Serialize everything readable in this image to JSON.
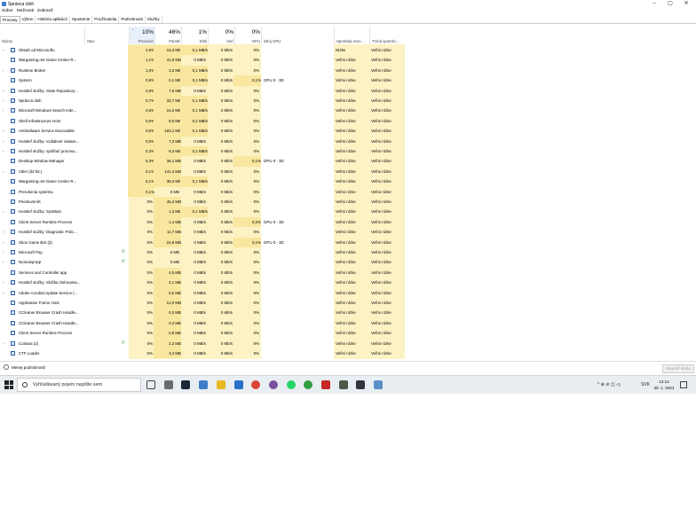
{
  "window": {
    "title": "Správca úloh",
    "minimize": "–",
    "maximize": "▢",
    "close": "✕"
  },
  "menu": [
    "Súbor",
    "Možnosti",
    "Zobraziť"
  ],
  "tabs": [
    "Procesy",
    "Výkon",
    "História aplikácií",
    "Spustenie",
    "Používatelia",
    "Podrobnosti",
    "Služby"
  ],
  "columns": {
    "name": "Názov",
    "status": "Stav",
    "cpu": {
      "pct": "10%",
      "label": "Procesor"
    },
    "mem": {
      "pct": "46%",
      "label": "Pamäť"
    },
    "disk": {
      "pct": "1%",
      "label": "Disk"
    },
    "net": {
      "pct": "0%",
      "label": "Sieť"
    },
    "gpu": {
      "pct": "0%",
      "label": "GPU"
    },
    "gpu_engine": "Stroj GPU",
    "power": "Spotreba ener...",
    "power_trend": "Trend spotreb..."
  },
  "rows": [
    {
      "name": "Obsah od Microsoftu",
      "cpu": "2,6%",
      "mem": "16,3 MB",
      "disk": "0,1 MB/s",
      "net": "0 Mb/s",
      "gpu": "0%",
      "engine": "",
      "power": "Nízke",
      "trend": "Veľmi nízke",
      "expand": true,
      "leaf": false
    },
    {
      "name": "Wargaming.net Game Center R...",
      "cpu": "1,1%",
      "mem": "41,9 MB",
      "disk": "0 MB/s",
      "net": "0 Mb/s",
      "gpu": "0%",
      "engine": "",
      "power": "Veľmi nízke",
      "trend": "Veľmi nízke",
      "expand": false,
      "leaf": false
    },
    {
      "name": "Runtime Broker",
      "cpu": "1,0%",
      "mem": "3,2 MB",
      "disk": "0,1 MB/s",
      "net": "0 Mb/s",
      "gpu": "0%",
      "engine": "",
      "power": "Veľmi nízke",
      "trend": "Veľmi nízke",
      "expand": true,
      "leaf": false
    },
    {
      "name": "System",
      "cpu": "0,9%",
      "mem": "0,1 MB",
      "disk": "0,1 MB/s",
      "net": "0 Mb/s",
      "gpu": "0,1%",
      "engine": "GPU 0 - 3D",
      "power": "Veľmi nízke",
      "trend": "Veľmi nízke",
      "expand": false,
      "leaf": false
    },
    {
      "name": "Hostiteľ služby: State Repository...",
      "cpu": "0,9%",
      "mem": "7,6 MB",
      "disk": "0 MB/s",
      "net": "0 Mb/s",
      "gpu": "0%",
      "engine": "",
      "power": "Veľmi nízke",
      "trend": "Veľmi nízke",
      "expand": true,
      "leaf": false
    },
    {
      "name": "Správca úloh",
      "cpu": "0,7%",
      "mem": "33,7 MB",
      "disk": "0,1 MB/s",
      "net": "0 Mb/s",
      "gpu": "0%",
      "engine": "",
      "power": "Veľmi nízke",
      "trend": "Veľmi nízke",
      "expand": true,
      "leaf": false
    },
    {
      "name": "Microsoft Windows Search Inde...",
      "cpu": "0,6%",
      "mem": "16,2 MB",
      "disk": "0,1 MB/s",
      "net": "0 Mb/s",
      "gpu": "0%",
      "engine": "",
      "power": "Veľmi nízke",
      "trend": "Veľmi nízke",
      "expand": true,
      "leaf": false
    },
    {
      "name": "Shell Infrastructure Host",
      "cpu": "0,6%",
      "mem": "8,0 MB",
      "disk": "0,1 MB/s",
      "net": "0 Mb/s",
      "gpu": "0%",
      "engine": "",
      "power": "Veľmi nízke",
      "trend": "Veľmi nízke",
      "expand": false,
      "leaf": false
    },
    {
      "name": "Antimalware Service Executable",
      "cpu": "0,5%",
      "mem": "183,1 MB",
      "disk": "0,1 MB/s",
      "net": "0 Mb/s",
      "gpu": "0%",
      "engine": "",
      "power": "Veľmi nízke",
      "trend": "Veľmi nízke",
      "expand": true,
      "leaf": false
    },
    {
      "name": "Hostiteľ služby: vzdialené volanie...",
      "cpu": "0,5%",
      "mem": "7,3 MB",
      "disk": "0 MB/s",
      "net": "0 Mb/s",
      "gpu": "0%",
      "engine": "",
      "power": "Veľmi nízke",
      "trend": "Veľmi nízke",
      "expand": true,
      "leaf": false
    },
    {
      "name": "Hostiteľ služby: spúšťač procesu...",
      "cpu": "0,3%",
      "mem": "9,3 MB",
      "disk": "0,1 MB/s",
      "net": "0 Mb/s",
      "gpu": "0%",
      "engine": "",
      "power": "Veľmi nízke",
      "trend": "Veľmi nízke",
      "expand": true,
      "leaf": false
    },
    {
      "name": "Desktop Window Manager",
      "cpu": "0,3%",
      "mem": "36,1 MB",
      "disk": "0 MB/s",
      "net": "0 Mb/s",
      "gpu": "0,1%",
      "engine": "GPU 0 - 3D",
      "power": "Veľmi nízke",
      "trend": "Veľmi nízke",
      "expand": false,
      "leaf": false
    },
    {
      "name": "Viber (32 bit.)",
      "cpu": "0,1%",
      "mem": "141,4 MB",
      "disk": "0 MB/s",
      "net": "0 Mb/s",
      "gpu": "0%",
      "engine": "",
      "power": "Veľmi nízke",
      "trend": "Veľmi nízke",
      "expand": true,
      "leaf": false
    },
    {
      "name": "Wargaming.net Game Center R...",
      "cpu": "0,1%",
      "mem": "38,4 MB",
      "disk": "0,1 MB/s",
      "net": "0 Mb/s",
      "gpu": "0%",
      "engine": "",
      "power": "Veľmi nízke",
      "trend": "Veľmi nízke",
      "expand": false,
      "leaf": false
    },
    {
      "name": "Prerušenia systému",
      "cpu": "0,1%",
      "mem": "0 MB",
      "disk": "0 MB/s",
      "net": "0 Mb/s",
      "gpu": "0%",
      "engine": "",
      "power": "Veľmi nízke",
      "trend": "Veľmi nízke",
      "expand": false,
      "leaf": false
    },
    {
      "name": "PrieskumníK",
      "cpu": "0%",
      "mem": "45,4 MB",
      "disk": "0 MB/s",
      "net": "0 Mb/s",
      "gpu": "0%",
      "engine": "",
      "power": "Veľmi nízke",
      "trend": "Veľmi nízke",
      "expand": false,
      "leaf": false
    },
    {
      "name": "Hostiteľ služby: SysMain",
      "cpu": "0%",
      "mem": "1,3 MB",
      "disk": "0,1 MB/s",
      "net": "0 Mb/s",
      "gpu": "0%",
      "engine": "",
      "power": "Veľmi nízke",
      "trend": "Veľmi nízke",
      "expand": true,
      "leaf": false
    },
    {
      "name": "Client Server Runtime Process",
      "cpu": "0%",
      "mem": "1,4 MB",
      "disk": "0 MB/s",
      "net": "0 Mb/s",
      "gpu": "0,2%",
      "engine": "GPU 0 - 3D",
      "power": "Veľmi nízke",
      "trend": "Veľmi nízke",
      "expand": false,
      "leaf": false
    },
    {
      "name": "Hostiteľ služby: Diagnostic Polic...",
      "cpu": "0%",
      "mem": "11,7 MB",
      "disk": "0 MB/s",
      "net": "0 Mb/s",
      "gpu": "0%",
      "engine": "",
      "power": "Veľmi nízke",
      "trend": "Veľmi nízke",
      "expand": true,
      "leaf": false
    },
    {
      "name": "Xbox Game Bar (3)",
      "cpu": "0%",
      "mem": "24,9 MB",
      "disk": "0 MB/s",
      "net": "0 Mb/s",
      "gpu": "0,1%",
      "engine": "GPU 0 - 3D",
      "power": "Veľmi nízke",
      "trend": "Veľmi nízke",
      "expand": true,
      "leaf": false
    },
    {
      "name": "Microsoft Pay",
      "cpu": "0%",
      "mem": "0 MB",
      "disk": "0 MB/s",
      "net": "0 Mb/s",
      "gpu": "0%",
      "engine": "",
      "power": "Veľmi nízke",
      "trend": "Veľmi nízke",
      "expand": true,
      "leaf": true
    },
    {
      "name": "NcsiUwpApp",
      "cpu": "0%",
      "mem": "0 MB",
      "disk": "0 MB/s",
      "net": "0 Mb/s",
      "gpu": "0%",
      "engine": "",
      "power": "Veľmi nízke",
      "trend": "Veľmi nízke",
      "expand": true,
      "leaf": true
    },
    {
      "name": "Services and Controller app",
      "cpu": "0%",
      "mem": "4,5 MB",
      "disk": "0 MB/s",
      "net": "0 Mb/s",
      "gpu": "0%",
      "engine": "",
      "power": "Veľmi nízke",
      "trend": "Veľmi nízke",
      "expand": false,
      "leaf": false
    },
    {
      "name": "Hostiteľ služby: Služba zisťovania...",
      "cpu": "0%",
      "mem": "2,1 MB",
      "disk": "0 MB/s",
      "net": "0 Mb/s",
      "gpu": "0%",
      "engine": "",
      "power": "Veľmi nízke",
      "trend": "Veľmi nízke",
      "expand": true,
      "leaf": false
    },
    {
      "name": "Adobe Acrobat Update Service (...",
      "cpu": "0%",
      "mem": "0,6 MB",
      "disk": "0 MB/s",
      "net": "0 Mb/s",
      "gpu": "0%",
      "engine": "",
      "power": "Veľmi nízke",
      "trend": "Veľmi nízke",
      "expand": true,
      "leaf": false
    },
    {
      "name": "Application Frame Host",
      "cpu": "0%",
      "mem": "12,0 MB",
      "disk": "0 MB/s",
      "net": "0 Mb/s",
      "gpu": "0%",
      "engine": "",
      "power": "Veľmi nízke",
      "trend": "Veľmi nízke",
      "expand": false,
      "leaf": false
    },
    {
      "name": "CCleaner Browser Crash Handle...",
      "cpu": "0%",
      "mem": "0,3 MB",
      "disk": "0 MB/s",
      "net": "0 Mb/s",
      "gpu": "0%",
      "engine": "",
      "power": "Veľmi nízke",
      "trend": "Veľmi nízke",
      "expand": false,
      "leaf": false
    },
    {
      "name": "CCleaner Browser Crash Handle...",
      "cpu": "0%",
      "mem": "0,3 MB",
      "disk": "0 MB/s",
      "net": "0 Mb/s",
      "gpu": "0%",
      "engine": "",
      "power": "Veľmi nízke",
      "trend": "Veľmi nízke",
      "expand": false,
      "leaf": false
    },
    {
      "name": "Client Server Runtime Process",
      "cpu": "0%",
      "mem": "0,9 MB",
      "disk": "0 MB/s",
      "net": "0 Mb/s",
      "gpu": "0%",
      "engine": "",
      "power": "Veľmi nízke",
      "trend": "Veľmi nízke",
      "expand": false,
      "leaf": false
    },
    {
      "name": "Cortana (2)",
      "cpu": "0%",
      "mem": "2,2 MB",
      "disk": "0 MB/s",
      "net": "0 Mb/s",
      "gpu": "0%",
      "engine": "",
      "power": "Veľmi nízke",
      "trend": "Veľmi nízke",
      "expand": true,
      "leaf": true
    },
    {
      "name": "CTF Loader",
      "cpu": "0%",
      "mem": "3,4 MB",
      "disk": "0 MB/s",
      "net": "0 Mb/s",
      "gpu": "0%",
      "engine": "",
      "power": "Veľmi nízke",
      "trend": "Veľmi nízke",
      "expand": false,
      "leaf": false
    }
  ],
  "footer": {
    "fewer_details": "Menej podrobností",
    "end_task": "Ukončiť úlohu"
  },
  "taskbar": {
    "search_placeholder": "Vyhľadávaný pojem napíšte sem",
    "apps": [
      "task-view-icon",
      "calculator-icon",
      "steam-icon",
      "notepad-icon",
      "file-explorer-icon",
      "mail-icon",
      "chrome-icon",
      "viber-icon",
      "whatsapp-icon",
      "utorrent-icon",
      "ccleaner-icon",
      "world-of-tanks-icon",
      "wargaming-icon",
      "task-manager-icon"
    ],
    "tray_text": "^ ⊕ ⊘ ◫ ◁ᵢ",
    "language": "SVK",
    "time": "13:12",
    "date": "30. 1. 2021"
  },
  "colors": {
    "accent": "#fcf2c4",
    "highlight": "#f9e79f",
    "taskbar": "#e9eef3"
  }
}
